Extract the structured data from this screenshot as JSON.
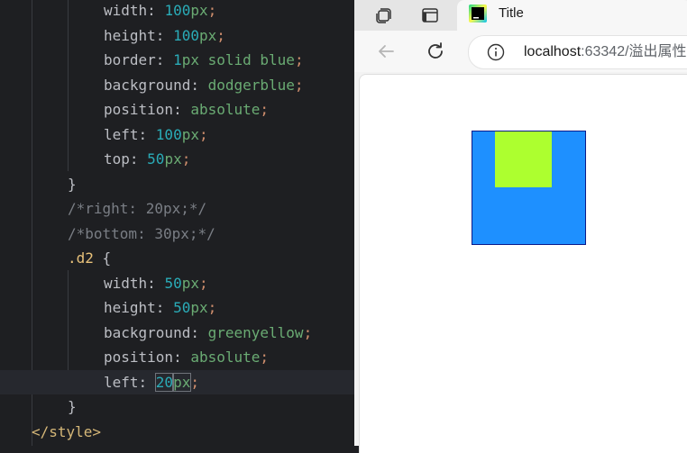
{
  "editor": {
    "lines": [
      {
        "indent": 2,
        "tokens": [
          [
            "prop",
            "width: "
          ],
          [
            "num",
            "100"
          ],
          [
            "unit",
            "px"
          ],
          [
            "semi",
            ";"
          ]
        ]
      },
      {
        "indent": 2,
        "tokens": [
          [
            "prop",
            "height: "
          ],
          [
            "num",
            "100"
          ],
          [
            "unit",
            "px"
          ],
          [
            "semi",
            ";"
          ]
        ]
      },
      {
        "indent": 2,
        "tokens": [
          [
            "prop",
            "border: "
          ],
          [
            "num",
            "1"
          ],
          [
            "unit",
            "px"
          ],
          [
            "str",
            " solid blue"
          ],
          [
            "semi",
            ";"
          ]
        ]
      },
      {
        "indent": 2,
        "tokens": [
          [
            "prop",
            "background: "
          ],
          [
            "str",
            "dodgerblue"
          ],
          [
            "semi",
            ";"
          ]
        ]
      },
      {
        "indent": 2,
        "tokens": [
          [
            "prop",
            "position: "
          ],
          [
            "str",
            "absolute"
          ],
          [
            "semi",
            ";"
          ]
        ]
      },
      {
        "indent": 2,
        "tokens": [
          [
            "prop",
            "left: "
          ],
          [
            "num",
            "100"
          ],
          [
            "unit",
            "px"
          ],
          [
            "semi",
            ";"
          ]
        ]
      },
      {
        "indent": 2,
        "tokens": [
          [
            "prop",
            "top: "
          ],
          [
            "num",
            "50"
          ],
          [
            "unit",
            "px"
          ],
          [
            "semi",
            ";"
          ]
        ]
      },
      {
        "indent": 1,
        "tokens": [
          [
            "brace",
            "}"
          ]
        ]
      },
      {
        "indent": 1,
        "tokens": [
          [
            "cmt",
            "/*right: 20px;*/"
          ]
        ]
      },
      {
        "indent": 1,
        "tokens": [
          [
            "cmt",
            "/*bottom: 30px;*/"
          ]
        ]
      },
      {
        "indent": 1,
        "tokens": [
          [
            "sel",
            ".d2"
          ],
          [
            "brace",
            " {"
          ]
        ]
      },
      {
        "indent": 2,
        "tokens": [
          [
            "prop",
            "width: "
          ],
          [
            "num",
            "50"
          ],
          [
            "unit",
            "px"
          ],
          [
            "semi",
            ";"
          ]
        ]
      },
      {
        "indent": 2,
        "tokens": [
          [
            "prop",
            "height: "
          ],
          [
            "num",
            "50"
          ],
          [
            "unit",
            "px"
          ],
          [
            "semi",
            ";"
          ]
        ]
      },
      {
        "indent": 2,
        "tokens": [
          [
            "prop",
            "background: "
          ],
          [
            "str",
            "greenyellow"
          ],
          [
            "semi",
            ";"
          ]
        ]
      },
      {
        "indent": 2,
        "tokens": [
          [
            "prop",
            "position: "
          ],
          [
            "str",
            "absolute"
          ],
          [
            "semi",
            ";"
          ]
        ]
      },
      {
        "indent": 2,
        "current": true,
        "tokens": [
          [
            "prop",
            "left: "
          ],
          [
            "num",
            "20",
            "box-caret"
          ],
          [
            "unit",
            "px",
            "box"
          ],
          [
            "semi",
            ";"
          ]
        ]
      },
      {
        "indent": 1,
        "tokens": [
          [
            "brace",
            "}"
          ]
        ]
      },
      {
        "indent": 0,
        "tokens": [
          [
            "tag",
            "</style>"
          ]
        ]
      }
    ]
  },
  "browser": {
    "tab": {
      "title": "Title",
      "favicon": "pycharm-icon"
    },
    "address": {
      "host": "localhost",
      "rest": ":63342/溢出属性"
    },
    "icons": {
      "workspaces": "workspaces-icon",
      "tab_actions": "vertical-tabs-icon",
      "back": "back-arrow-icon",
      "reload": "reload-icon",
      "info": "site-info-icon"
    },
    "colors": {
      "outer_box": "#1E90FF",
      "inner_box": "#ADFF2F",
      "outer_border": "#0000FF"
    }
  }
}
